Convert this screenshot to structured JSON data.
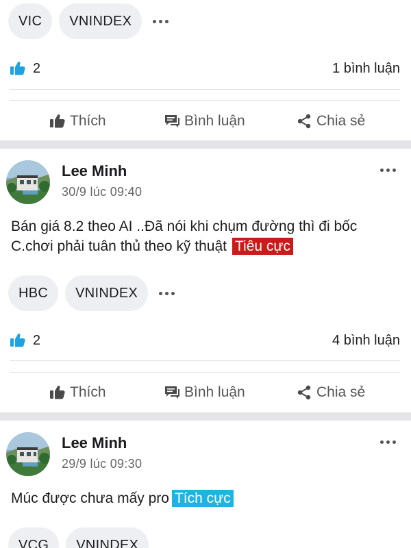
{
  "post0": {
    "tags": [
      "VIC",
      "VNINDEX"
    ],
    "likes": "2",
    "comments": "1 bình luận"
  },
  "actions": {
    "like": "Thích",
    "comment": "Bình luận",
    "share": "Chia sẻ"
  },
  "post1": {
    "author": "Lee Minh",
    "time": "30/9 lúc 09:40",
    "content": "Bán giá 8.2 theo AI ..Đã nói khi chụm đường thì đi bốc C.chơi phải tuân thủ theo kỹ thuật",
    "sentiment": "Tiêu cực",
    "tags": [
      "HBC",
      "VNINDEX"
    ],
    "likes": "2",
    "comments": "4 bình luận"
  },
  "post2": {
    "author": "Lee Minh",
    "time": "29/9 lúc 09:30",
    "content": "Múc được chưa mấy pro",
    "sentiment": "Tích cực",
    "tags": [
      "VCG",
      "VNINDEX"
    ]
  },
  "colors": {
    "like_blue": "#1fa3e0",
    "negative": "#cc1a1a",
    "positive": "#1fb4e0",
    "separator": "#e4e4e6"
  },
  "icons": [
    "more-dots-icon",
    "thumbs-up-filled-icon",
    "thumbs-up-outline-icon",
    "comment-bubble-icon",
    "share-icon"
  ]
}
